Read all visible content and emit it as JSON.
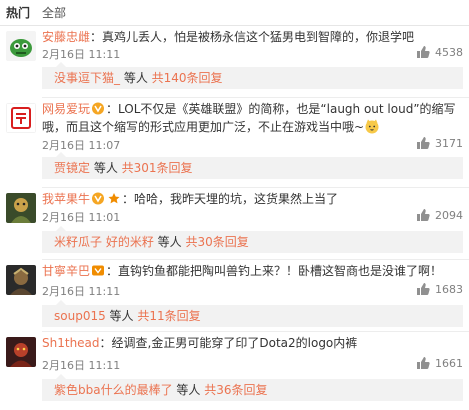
{
  "tabs": [
    {
      "label": "热门"
    },
    {
      "label": "全部"
    }
  ],
  "colors": {
    "accent": "#eb7350",
    "meta": "#808080",
    "reply_bg": "#f2f2f2"
  },
  "comments": [
    {
      "user": "安藤忠雌",
      "separator": "：",
      "text": "真鸡儿丢人，怕是被杨永信这个猛男电到智障的，你退学吧",
      "time": "2月16日 11:11",
      "likes": "4538",
      "avatar": "green-robot-avatar",
      "reply_user": "没事逗下猫_",
      "reply_mid": " 等人 ",
      "reply_more": "共140条回复"
    },
    {
      "user": "网易爱玩",
      "separator": "：",
      "text": "LOL不仅是《英雄联盟》的简称，也是“laugh out loud”的缩写哦，而且这个缩写的形式应用更加广泛，不止在游戏当中哦~",
      "time": "2月16日 11:07",
      "likes": "3171",
      "avatar": "netease-play-logo",
      "reply_user": "贾镜定",
      "reply_mid": " 等人 ",
      "reply_more": "共301条回复"
    },
    {
      "user": "我苹果牛",
      "separator": "：",
      "text": "哈哈，我昨天埋的坑，这货果然上当了",
      "time": "2月16日 11:01",
      "likes": "2094",
      "avatar": "game-character-avatar",
      "reply_user": "米籽瓜子 好的米籽",
      "reply_mid": " 等人 ",
      "reply_more": "共30条回复"
    },
    {
      "user": "甘寧辛巴",
      "separator": "：",
      "text": "直钩钓鱼都能把陶叫兽钓上来？！卧槽这智商也是没谁了啊！",
      "time": "2月16日 11:11",
      "likes": "1683",
      "avatar": "dark-warrior-avatar",
      "reply_user": "soup015",
      "reply_mid": " 等人 ",
      "reply_more": "共11条回复"
    },
    {
      "user": "Sh1thead",
      "separator": "：",
      "text": "经调查,金正男可能穿了印了Dota2的logo内裤",
      "time": "2月16日 11:11",
      "likes": "1661",
      "avatar": "red-hero-avatar",
      "reply_user": "紫色bba什么的最棒了",
      "reply_mid": " 等人 ",
      "reply_more": "共36条回复"
    }
  ]
}
